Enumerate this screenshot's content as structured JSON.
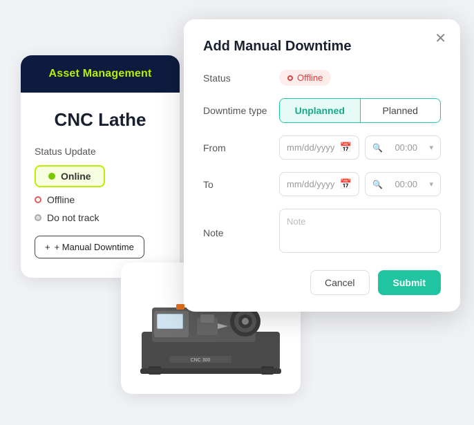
{
  "assetCard": {
    "headerTitle": "Asset Management",
    "assetName": "CNC Lathe",
    "statusUpdateLabel": "Status Update",
    "statusOptions": [
      {
        "key": "online",
        "label": "Online",
        "active": true
      },
      {
        "key": "offline",
        "label": "Offline",
        "active": false
      },
      {
        "key": "donottrack",
        "label": "Do not track",
        "active": false
      }
    ],
    "manualDowntimeBtn": "+ Manual Downtime"
  },
  "modal": {
    "title": "Add Manual Downtime",
    "closeIcon": "✕",
    "statusLabel": "Status",
    "statusBadge": "Offline",
    "downtypeLabel": "Downtime type",
    "toggleOptions": [
      {
        "key": "unplanned",
        "label": "Unplanned",
        "active": true
      },
      {
        "key": "planned",
        "label": "Planned",
        "active": false
      }
    ],
    "fromLabel": "From",
    "toLabel": "To",
    "noteLabel": "Note",
    "dateplaceholder": "mm/dd/yyyy",
    "timePlaceholder": "00:00",
    "notePlaceholder": "Note",
    "cancelBtn": "Cancel",
    "submitBtn": "Submit"
  },
  "colors": {
    "accent": "#20c4a0",
    "header": "#0d1b3e",
    "lime": "#b8f000",
    "offline": "#d94040"
  }
}
